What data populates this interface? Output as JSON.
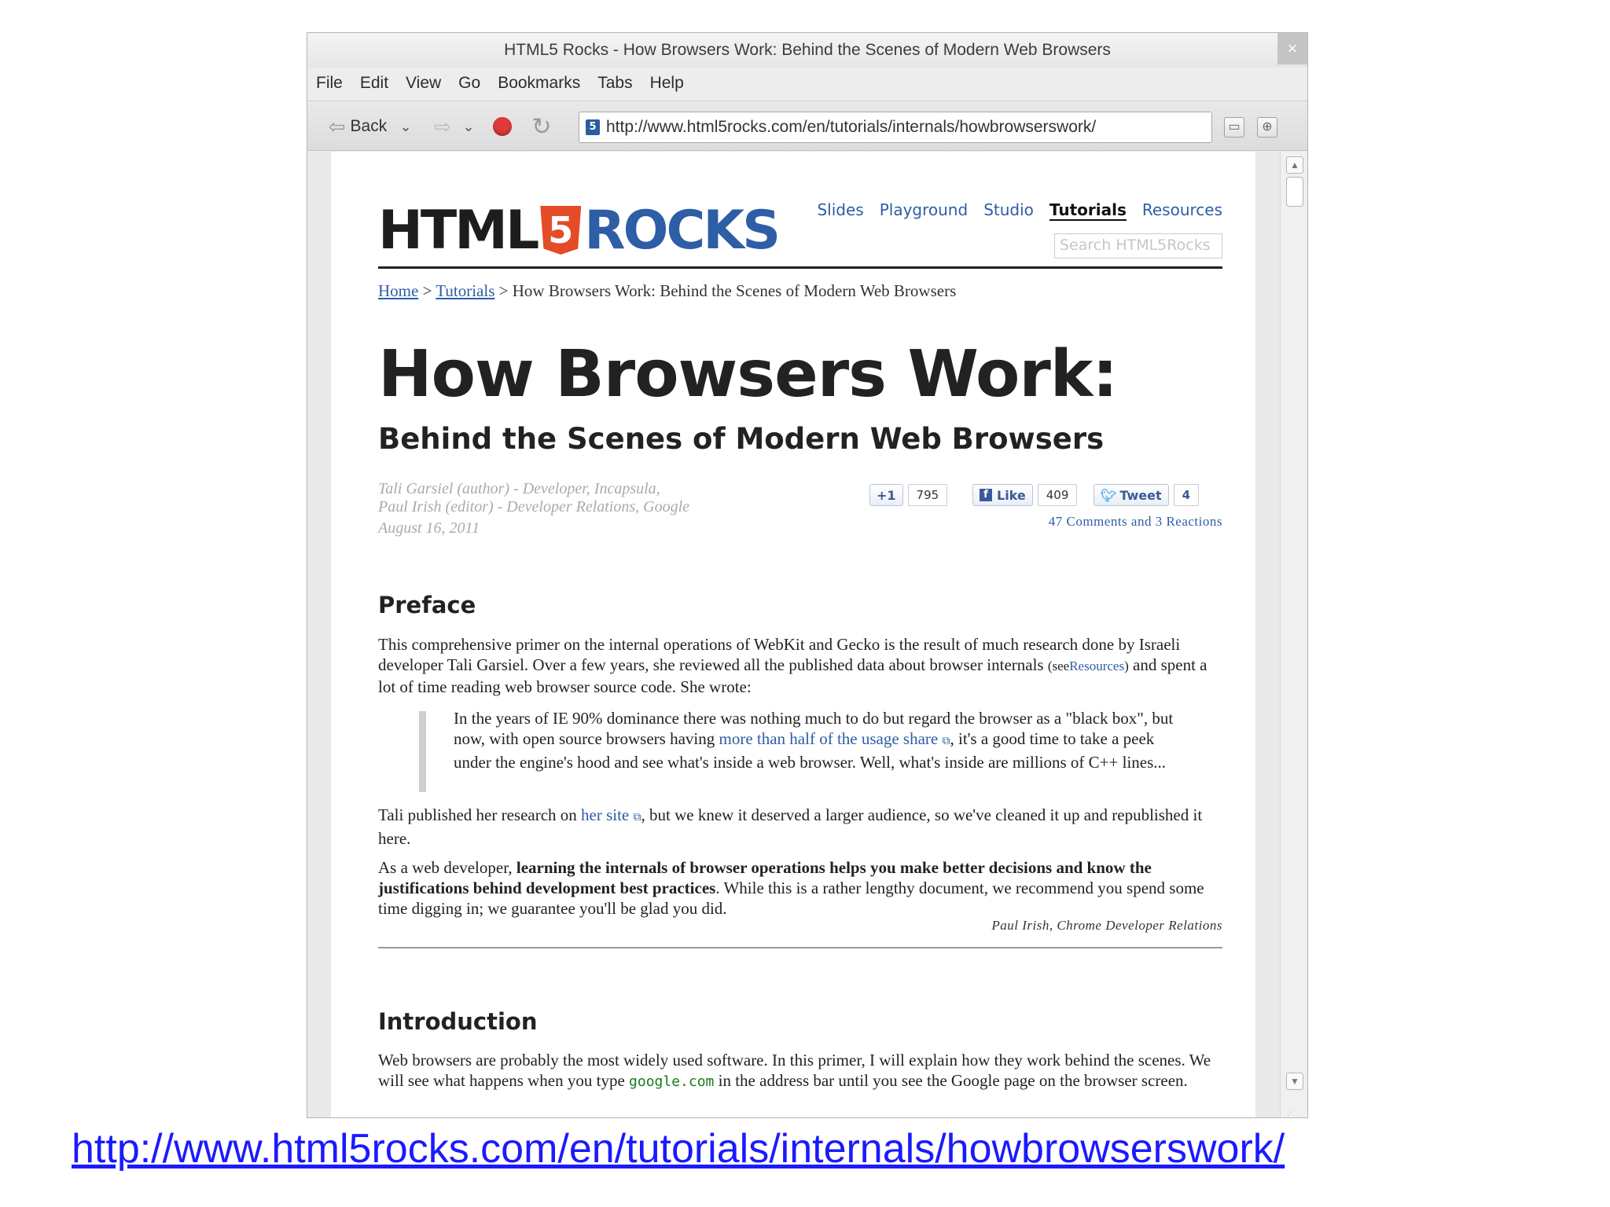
{
  "window": {
    "title": "HTML5 Rocks - How Browsers Work: Behind the Scenes of Modern Web Browsers",
    "close_glyph": "×"
  },
  "menu": [
    "File",
    "Edit",
    "View",
    "Go",
    "Bookmarks",
    "Tabs",
    "Help"
  ],
  "toolbar": {
    "back_label": "Back",
    "url": "http://www.html5rocks.com/en/tutorials/internals/howbrowserswork/"
  },
  "site": {
    "logo": {
      "part1": "HTML",
      "part2": "5",
      "part3": "ROCKS"
    },
    "nav": [
      "Slides",
      "Playground",
      "Studio",
      "Tutorials",
      "Resources"
    ],
    "nav_active": "Tutorials",
    "search_placeholder": "Search HTML5Rocks"
  },
  "breadcrumb": {
    "home": "Home",
    "sep": ">",
    "tutorials": "Tutorials",
    "current": "How Browsers Work: Behind the Scenes of Modern Web Browsers"
  },
  "article": {
    "title": "How Browsers Work:",
    "subtitle": "Behind the Scenes of Modern Web Browsers",
    "author_line1": "Tali Garsiel (author) - Developer, Incapsula,",
    "author_line2": "Paul Irish (editor) - Developer Relations, Google",
    "date": "August 16, 2011"
  },
  "social": {
    "plusone_label": "+1",
    "plusone_count": "795",
    "like_label": "Like",
    "like_count": "409",
    "tweet_label": "Tweet",
    "tweet_count": "4",
    "comments": "47 Comments and 3 Reactions"
  },
  "preface": {
    "heading": "Preface",
    "p1_a": "This comprehensive primer on the internal operations of WebKit and Gecko is the result of much research done by Israeli developer Tali Garsiel. Over a few years, she reviewed all the published data about browser internals",
    "p1_see": "(see",
    "p1_link": "Resources",
    "p1_close": ")",
    "p1_b": "and spent a lot of time reading web browser source code. She wrote:",
    "quote_a": "In the years of IE 90% dominance there was nothing much to do but regard the browser as a \"black box\", but now, with open source browsers having",
    "quote_link": "more than half of the usage share",
    "quote_b": ", it's a good time to take a peek under the engine's hood and see what's inside a web browser. Well, what's inside are millions of C++ lines...",
    "p2_a": "Tali published her research on",
    "p2_link": "her site",
    "p2_b": ", but we knew it deserved a larger audience, so we've cleaned it up and republished it here.",
    "p3_a": "As a web developer,",
    "p3_bold": "learning the internals of browser operations helps you make better decisions and know the justifications behind development best practices",
    "p3_b": ". While this is a rather lengthy document, we recommend you spend some time digging in; we guarantee you'll be glad you did.",
    "signature": "Paul Irish, Chrome Developer Relations"
  },
  "introduction": {
    "heading": "Introduction",
    "p1_a": "Web browsers are probably the most widely used software. In this primer, I will explain how they work behind the scenes. We will see what happens when you type",
    "p1_code": "google.com",
    "p1_b": "in the address bar until you see the Google page on the browser screen."
  },
  "caption_link": "http://www.html5rocks.com/en/tutorials/internals/howbrowserswork/",
  "colors": {
    "link": "#2d5ea6",
    "html5_badge": "#e34c26",
    "stop_button": "#e03a3a",
    "caption_link": "#1a1aff"
  }
}
